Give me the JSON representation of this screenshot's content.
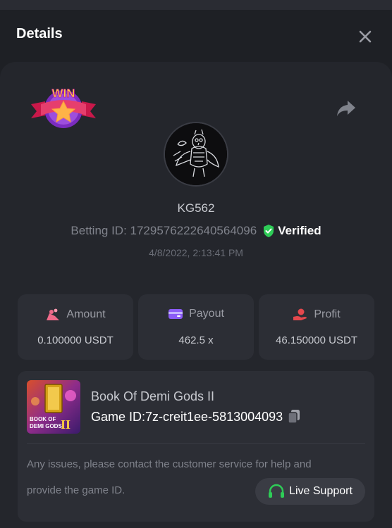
{
  "header": {
    "title": "Details"
  },
  "badge": {
    "text": "WIN"
  },
  "player": {
    "username": "KG562",
    "betting_id": "Betting ID: 1729576222640564096",
    "verified_label": "Verified",
    "timestamp": "4/8/2022, 2:13:41 PM"
  },
  "stats": [
    {
      "label": "Amount",
      "value": "0.100000 USDT",
      "icon": "coins-icon"
    },
    {
      "label": "Payout",
      "value": "462.5 x",
      "icon": "wallet-icon"
    },
    {
      "label": "Profit",
      "value": "46.150000 USDT",
      "icon": "profit-hand-icon"
    }
  ],
  "game": {
    "title": "Book Of Demi Gods II",
    "id": "Game ID:7z-creit1ee-5813004093",
    "thumb_text_1": "BOOK OF",
    "thumb_text_2": "DEMI GODS",
    "thumb_text_3": "II"
  },
  "support": {
    "notice_line1": "Any issues, please contact the customer service for help and",
    "notice_line2": "provide the game ID.",
    "button_label": "Live Support"
  },
  "colors": {
    "background": "#1a1c21",
    "card": "#24262c",
    "box": "#2c2e35",
    "verified_green": "#2ecc57",
    "payout_purple": "#8b5cf6",
    "profit_red": "#e5484d",
    "amount_pink": "#f06a8a"
  }
}
